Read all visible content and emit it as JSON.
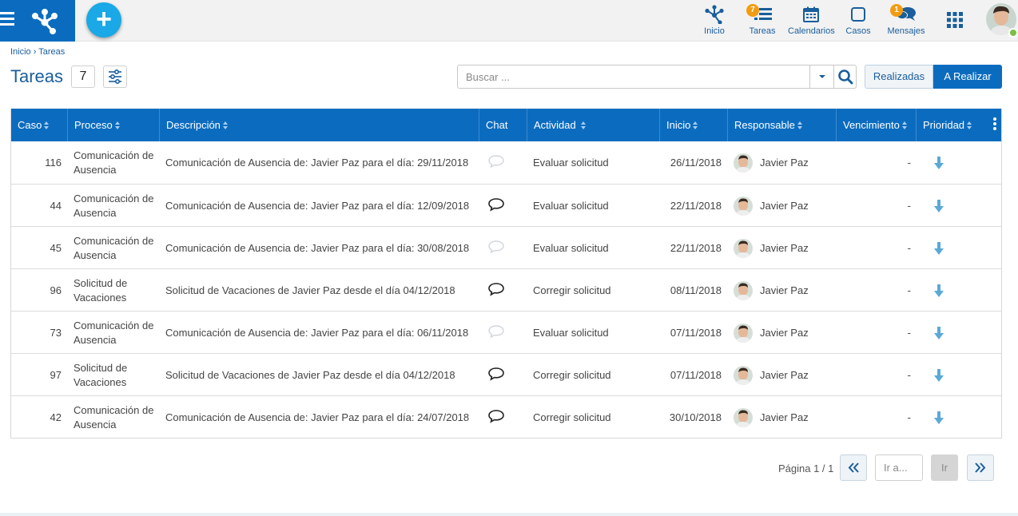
{
  "colors": {
    "brand": "#0b6cbf",
    "fab": "#1aa8e6",
    "badge": "#f39c12",
    "link": "#1a5e9c",
    "priority_arrow": "#5aa9d8",
    "online": "#7ac143"
  },
  "nav": {
    "items": [
      {
        "label": "Inicio",
        "icon": "process-node-icon"
      },
      {
        "label": "Tareas",
        "icon": "tasks-list-icon",
        "badge": "7"
      },
      {
        "label": "Calendarios",
        "icon": "calendar-icon"
      },
      {
        "label": "Casos",
        "icon": "cases-square-icon"
      },
      {
        "label": "Mensajes",
        "icon": "chat-bubbles-icon",
        "badge": "1"
      }
    ],
    "apps_icon": "apps-grid-icon",
    "fab_label": "+"
  },
  "breadcrumb": {
    "home": "Inicio",
    "separator": "›",
    "current": "Tareas"
  },
  "page": {
    "title": "Tareas",
    "count": "7"
  },
  "search": {
    "placeholder": "Buscar ..."
  },
  "toggle": {
    "done": "Realizadas",
    "todo": "A Realizar"
  },
  "table": {
    "columns": [
      "Caso",
      "Proceso",
      "Descripción",
      "Chat",
      "Actividad",
      "Inicio",
      "Responsable",
      "Vencimiento",
      "Prioridad"
    ],
    "rows": [
      {
        "caso": "116",
        "proceso": "Comunicación de Ausencia",
        "descripcion": "Comunicación de Ausencia de: Javier Paz para el día: 29/11/2018",
        "chat": "empty",
        "actividad": "Evaluar solicitud",
        "inicio": "26/11/2018",
        "responsable": "Javier Paz",
        "vencimiento": "-"
      },
      {
        "caso": "44",
        "proceso": "Comunicación de Ausencia",
        "descripcion": "Comunicación de Ausencia de: Javier Paz para el día: 12/09/2018",
        "chat": "active",
        "actividad": "Evaluar solicitud",
        "inicio": "22/11/2018",
        "responsable": "Javier Paz",
        "vencimiento": "-"
      },
      {
        "caso": "45",
        "proceso": "Comunicación de Ausencia",
        "descripcion": "Comunicación de Ausencia de: Javier Paz para el día: 30/08/2018",
        "chat": "empty",
        "actividad": "Evaluar solicitud",
        "inicio": "22/11/2018",
        "responsable": "Javier Paz",
        "vencimiento": "-"
      },
      {
        "caso": "96",
        "proceso": "Solicitud de Vacaciones",
        "descripcion": "Solicitud de Vacaciones de Javier Paz desde el día 04/12/2018",
        "chat": "active",
        "actividad": "Corregir solicitud",
        "inicio": "08/11/2018",
        "responsable": "Javier Paz",
        "vencimiento": "-"
      },
      {
        "caso": "73",
        "proceso": "Comunicación de Ausencia",
        "descripcion": "Comunicación de Ausencia de: Javier Paz para el día: 06/11/2018",
        "chat": "empty",
        "actividad": "Evaluar solicitud",
        "inicio": "07/11/2018",
        "responsable": "Javier Paz",
        "vencimiento": "-"
      },
      {
        "caso": "97",
        "proceso": "Solicitud de Vacaciones",
        "descripcion": "Solicitud de Vacaciones de Javier Paz desde el día 04/12/2018",
        "chat": "active",
        "actividad": "Corregir solicitud",
        "inicio": "07/11/2018",
        "responsable": "Javier Paz",
        "vencimiento": "-"
      },
      {
        "caso": "42",
        "proceso": "Comunicación de Ausencia",
        "descripcion": "Comunicación de Ausencia de: Javier Paz para el día: 24/07/2018",
        "chat": "active",
        "actividad": "Corregir solicitud",
        "inicio": "30/10/2018",
        "responsable": "Javier Paz",
        "vencimiento": "-"
      }
    ]
  },
  "pagination": {
    "label": "Página 1 / 1",
    "goto_placeholder": "Ir a...",
    "go_label": "Ir"
  }
}
